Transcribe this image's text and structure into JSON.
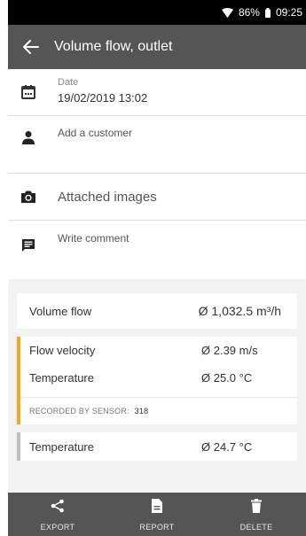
{
  "status": {
    "battery": "86%",
    "time": "09:25"
  },
  "appbar": {
    "title": "Volume flow, outlet"
  },
  "details": {
    "date_label": "Date",
    "date_value": "19/02/2019 13:02",
    "customer": "Add a customer",
    "images": "Attached images",
    "comment": "Write comment"
  },
  "measurements": {
    "volume_flow": {
      "label": "Volume flow",
      "value": "Ø 1,032.5 m³/h"
    },
    "sensor_group": {
      "accent": "#f5a623",
      "rows": [
        {
          "label": "Flow velocity",
          "value": "Ø 2.39 m/s"
        },
        {
          "label": "Temperature",
          "value": "Ø 25.0 °C"
        }
      ],
      "recorded_label": "RECORDED BY SENSOR:",
      "sensor_number": "318"
    },
    "temperature2": {
      "label": "Temperature",
      "value": "Ø 24.7 °C"
    }
  },
  "bottom_bar": {
    "export": "EXPORT",
    "report": "REPORT",
    "delete": "DELETE"
  }
}
